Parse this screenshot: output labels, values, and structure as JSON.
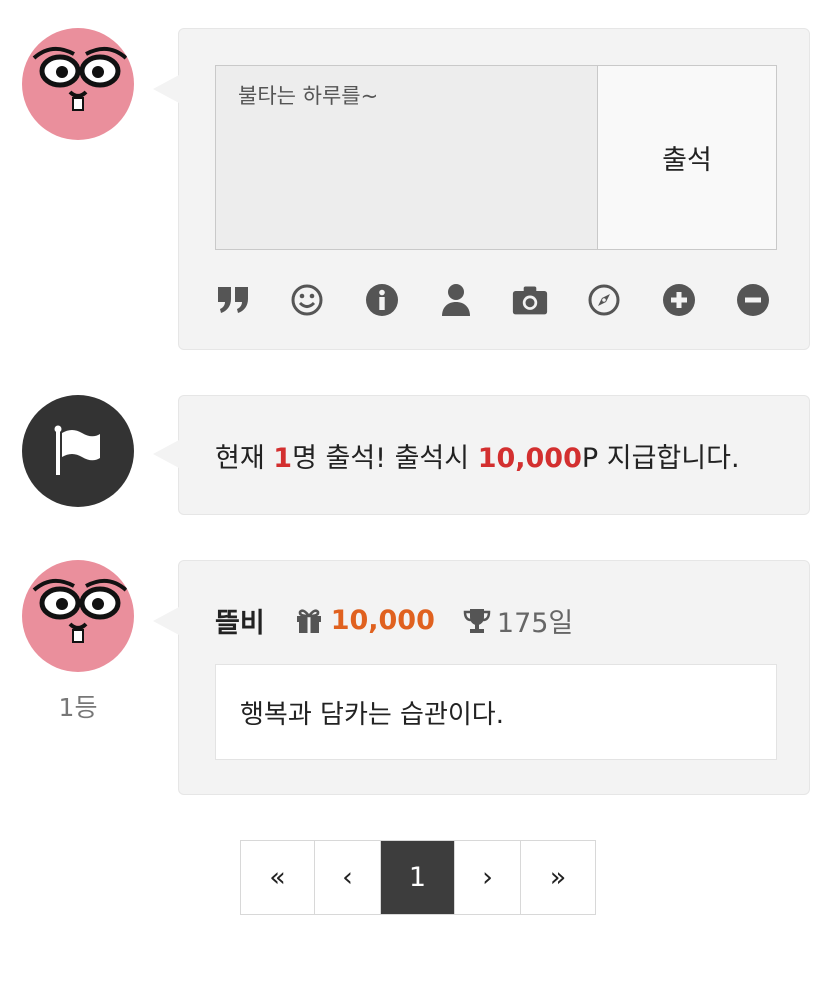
{
  "checkin_form": {
    "memo_value": "불타는 하루를~",
    "submit_label": "출석",
    "toolbar_icons": [
      "quote-icon",
      "smiley-icon",
      "info-icon",
      "user-icon",
      "camera-icon",
      "compass-icon",
      "plus-circle-icon",
      "minus-circle-icon"
    ]
  },
  "notice": {
    "prefix": "현재 ",
    "count": "1",
    "middle": "명 출석! 출석시 ",
    "points": "10,000",
    "suffix": "P 지급합니다."
  },
  "entries": [
    {
      "rank": "1등",
      "username": "뜰비",
      "points": "10,000",
      "days": "175일",
      "message": "행복과 담카는 습관이다."
    }
  ],
  "pagination": {
    "first": "«",
    "prev": "‹",
    "current": "1",
    "next": "›",
    "last": "»"
  },
  "colors": {
    "accent_red": "#d32f2f",
    "accent_orange": "#e0611f",
    "avatar_pink": "#ea8f9c",
    "active_page": "#3d3d3d"
  }
}
